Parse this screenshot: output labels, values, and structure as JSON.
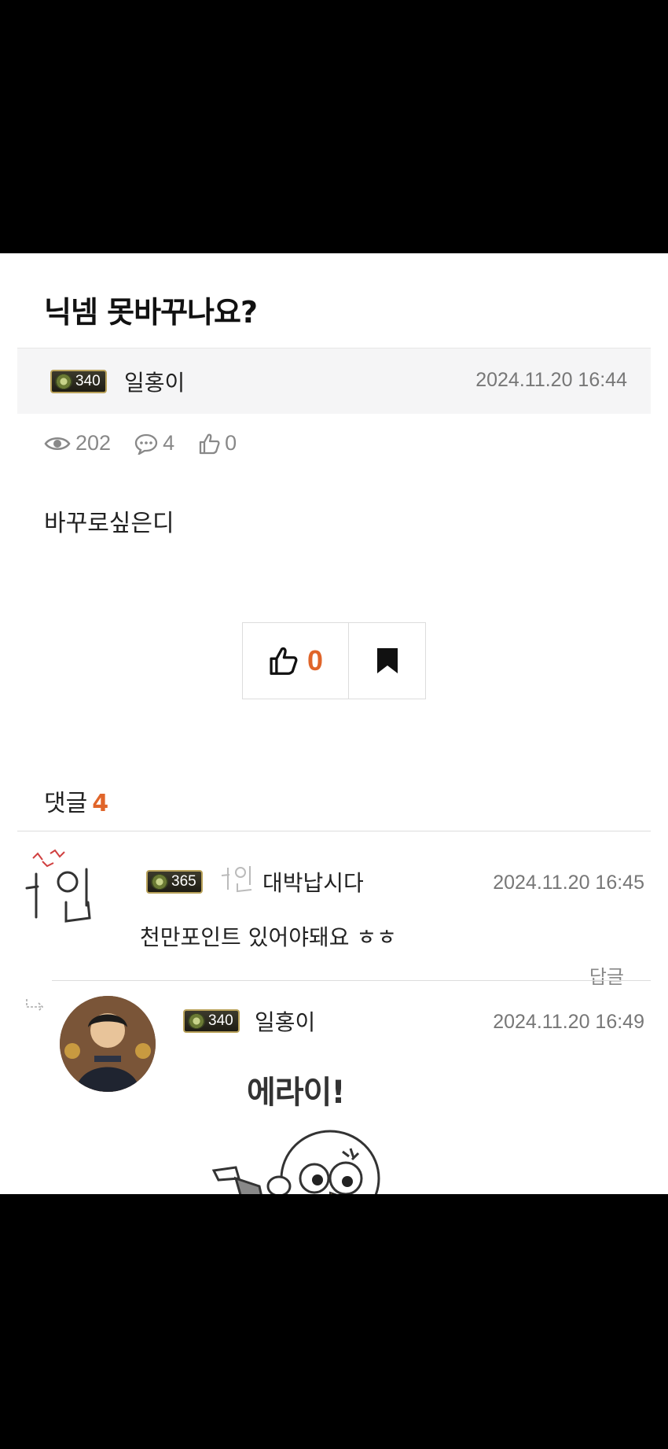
{
  "post": {
    "title": "닉넴 못바꾸나요?",
    "author": {
      "level": "340",
      "name": "일홍이"
    },
    "timestamp": "2024.11.20 16:44",
    "stats": {
      "views": "202",
      "comments": "4",
      "likes": "0"
    },
    "body": "바꾸로싶은디"
  },
  "actions": {
    "like_count": "0"
  },
  "comments_section": {
    "label": "댓글",
    "count": "4",
    "items": [
      {
        "level": "365",
        "name": "대박납시다",
        "timestamp": "2024.11.20 16:45",
        "text": "천만포인트 있어야돼요 ㅎㅎ",
        "reply_label": "답글"
      },
      {
        "level": "340",
        "name": "일홍이",
        "timestamp": "2024.11.20 16:49",
        "sticker_text": "에라이!"
      }
    ]
  },
  "colors": {
    "accent": "#e0652a",
    "badge_border": "#b9a25a"
  },
  "icons": [
    "eye-icon",
    "comment-bubble-icon",
    "thumbs-up-icon",
    "bookmark-icon",
    "reply-arrow-icon"
  ]
}
